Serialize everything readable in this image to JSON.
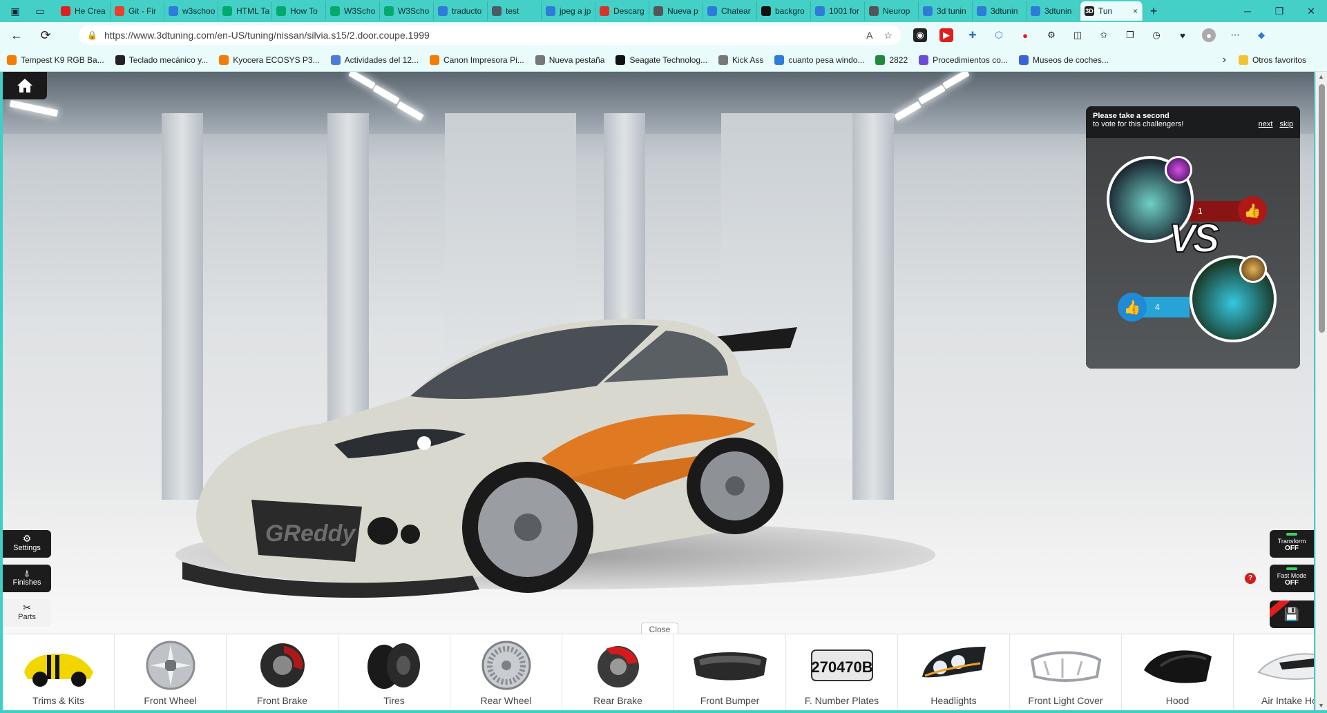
{
  "tabs": [
    {
      "label": "He Crea",
      "fav": "#e21d1d"
    },
    {
      "label": "Git - Fir",
      "fav": "#e8402d"
    },
    {
      "label": "w3schoo",
      "fav": "#2f7bd8"
    },
    {
      "label": "HTML Ta",
      "fav": "#04aa6d"
    },
    {
      "label": "How To",
      "fav": "#04aa6d"
    },
    {
      "label": "W3Scho",
      "fav": "#04aa6d"
    },
    {
      "label": "W3Scho",
      "fav": "#04aa6d"
    },
    {
      "label": "traducto",
      "fav": "#2f7bd8"
    },
    {
      "label": "test",
      "fav": "#4b5a66"
    },
    {
      "label": "jpeg a jp",
      "fav": "#2f7bd8"
    },
    {
      "label": "Descarg",
      "fav": "#d9342b"
    },
    {
      "label": "Nueva p",
      "fav": "#555555"
    },
    {
      "label": "Chatear",
      "fav": "#2f7bd8"
    },
    {
      "label": "backgro",
      "fav": "#111111"
    },
    {
      "label": "1001 for",
      "fav": "#2f7bd8"
    },
    {
      "label": "Neurop",
      "fav": "#555555"
    },
    {
      "label": "3d tunin",
      "fav": "#2f7bd8"
    },
    {
      "label": "3dtunin",
      "fav": "#2f7bd8"
    },
    {
      "label": "3dtunin",
      "fav": "#2f7bd8"
    }
  ],
  "active_tab": {
    "label": "Tun",
    "close": "×"
  },
  "new_tab": "+",
  "window_controls": [
    "─",
    "❐",
    "✕"
  ],
  "address": {
    "url": "https://www.3dtuning.com/en-US/tuning/nissan/silvia.s15/2.door.coupe.1999"
  },
  "bookmarks": [
    {
      "label": "Tempest K9 RGB Ba...",
      "color": "#f57c00"
    },
    {
      "label": "Teclado mecánico y...",
      "color": "#222222"
    },
    {
      "label": "Kyocera ECOSYS P3...",
      "color": "#f57c00"
    },
    {
      "label": "Actividades del 12...",
      "color": "#4a7bd8"
    },
    {
      "label": "Canon Impresora Pi...",
      "color": "#f57c00"
    },
    {
      "label": "Nueva pestaña",
      "color": "#777777"
    },
    {
      "label": "Seagate Technolog...",
      "color": "#111111"
    },
    {
      "label": "Kick Ass",
      "color": "#777777"
    },
    {
      "label": "cuanto pesa windo...",
      "color": "#2f7bd8"
    },
    {
      "label": "2822",
      "color": "#1e8a3a"
    },
    {
      "label": "Procedimientos co...",
      "color": "#6b4bd8"
    },
    {
      "label": "Museos de coches...",
      "color": "#3a63d8"
    }
  ],
  "bookmarks_more": "›",
  "other_favorites": "Otros favoritos",
  "vote": {
    "title": "Please take a second",
    "subtitle": "to vote for this challengers!",
    "next": "next",
    "skip": "skip",
    "vs": "VS",
    "top_count": "1",
    "bottom_count": "4"
  },
  "left_buttons": {
    "settings": "Settings",
    "finishes": "Finishes",
    "parts": "Parts"
  },
  "right_toggles": {
    "transform_label": "Transform",
    "transform_state": "OFF",
    "fastmode_label": "Fast Mode",
    "fastmode_state": "OFF",
    "badge": "?"
  },
  "close_label": "Close",
  "parts": [
    "Trims & Kits",
    "Front Wheel",
    "Front Brake",
    "Tires",
    "Rear Wheel",
    "Rear Brake",
    "Front Bumper",
    "F. Number Plates",
    "Headlights",
    "Front Light Cover",
    "Hood",
    "Air Intake Ho"
  ],
  "plate_text": "270470B"
}
